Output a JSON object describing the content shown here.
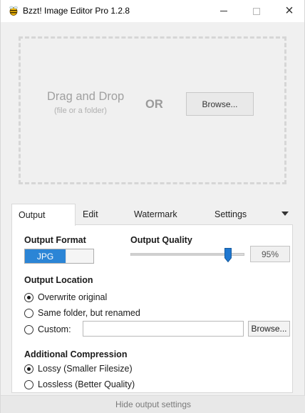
{
  "window": {
    "title": "Bzzt! Image Editor Pro 1.2.8",
    "icon": "bee-icon",
    "controls": {
      "minimize": "minimize-icon",
      "maximize": "maximize-icon",
      "close": "×"
    }
  },
  "drop_zone": {
    "title": "Drag and Drop",
    "subtitle": "(file or a folder)",
    "or_label": "OR",
    "browse_label": "Browse..."
  },
  "tabs": [
    {
      "label": "Output",
      "active": true
    },
    {
      "label": "Edit",
      "active": false
    },
    {
      "label": "Watermark",
      "active": false
    },
    {
      "label": "Settings",
      "active": false
    }
  ],
  "output": {
    "format_label": "Output Format",
    "format_selected": "JPG",
    "quality_label": "Output Quality",
    "quality_value": "95%",
    "quality_level": 0.95,
    "location_label": "Output Location",
    "location_options": [
      {
        "label": "Overwrite original",
        "checked": true
      },
      {
        "label": "Same folder, but renamed",
        "checked": false
      },
      {
        "label": "Custom:",
        "checked": false
      }
    ],
    "custom_path_value": "",
    "browse_label": "Browse...",
    "compression_label": "Additional Compression",
    "compression_options": [
      {
        "label": "Lossy (Smaller Filesize)",
        "checked": true
      },
      {
        "label": "Lossless (Better Quality)",
        "checked": false
      }
    ]
  },
  "footer": {
    "hide_label": "Hide output settings"
  },
  "colors": {
    "accent": "#2b85d6",
    "panel_bg": "#f0f0f0",
    "tab_body_bg": "#ffffff"
  }
}
